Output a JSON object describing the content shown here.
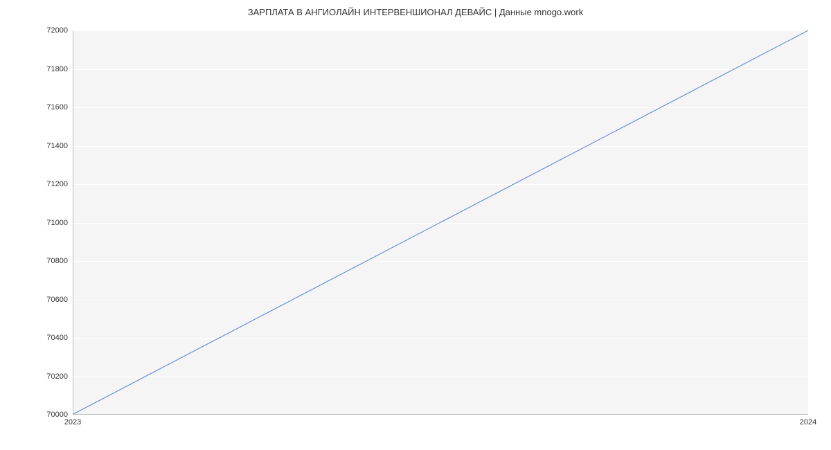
{
  "chart_data": {
    "type": "line",
    "title": "ЗАРПЛАТА В  АНГИОЛАЙН ИНТЕРВЕНШИОНАЛ ДЕВАЙС | Данные mnogo.work",
    "xlabel": "",
    "ylabel": "",
    "x": [
      2023,
      2024
    ],
    "values": [
      70000,
      72000
    ],
    "x_ticks": [
      "2023",
      "2024"
    ],
    "y_ticks": [
      70000,
      70200,
      70400,
      70600,
      70800,
      71000,
      71200,
      71400,
      71600,
      71800,
      72000
    ],
    "xlim": [
      2023,
      2024
    ],
    "ylim": [
      70000,
      72000
    ],
    "line_color": "#6a8fd8"
  }
}
